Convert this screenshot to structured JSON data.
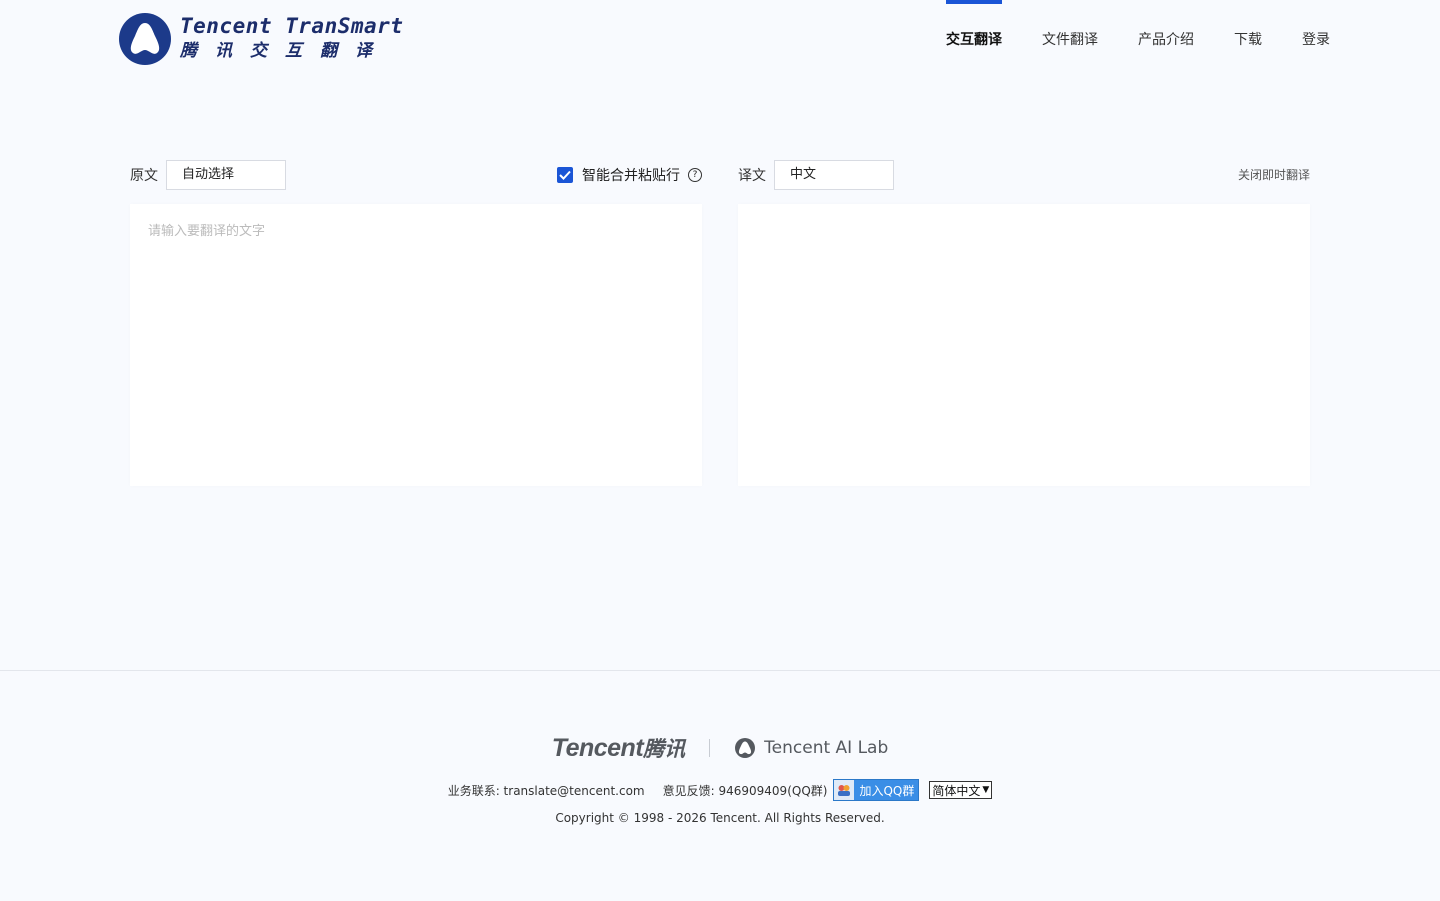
{
  "header": {
    "logo_en": "Tencent TranSmart",
    "logo_cn": "腾讯交互翻译",
    "nav": [
      {
        "label": "交互翻译",
        "active": true
      },
      {
        "label": "文件翻译",
        "active": false
      },
      {
        "label": "产品介绍",
        "active": false
      },
      {
        "label": "下载",
        "active": false
      },
      {
        "label": "登录",
        "active": false
      }
    ]
  },
  "translator": {
    "source_label": "原文",
    "source_lang": "自动选择",
    "merge_label": "智能合并粘贴行",
    "merge_checked": true,
    "target_label": "译文",
    "target_lang": "中文",
    "close_instant": "关闭即时翻译",
    "input_placeholder": "请输入要翻译的文字",
    "input_value": "",
    "output_value": ""
  },
  "footer": {
    "tencent_logo_en": "Tencent",
    "tencent_logo_cn": "腾讯",
    "ailab": "Tencent AI Lab",
    "business_contact": "业务联系: translate@tencent.com",
    "feedback": "意见反馈: 946909409(QQ群)",
    "qq_button": "加入QQ群",
    "language_select": "简体中文",
    "copyright": "Copyright © 1998 - 2026 Tencent. All Rights Reserved."
  },
  "colors": {
    "accent": "#1a55d6",
    "background": "#f8fafe",
    "logo_navy": "#1c3a8a"
  }
}
